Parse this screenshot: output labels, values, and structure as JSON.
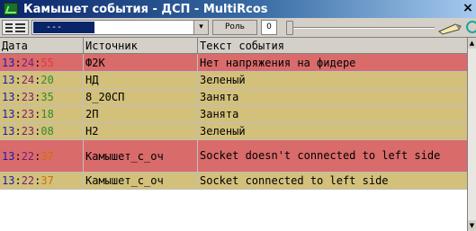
{
  "window": {
    "title": "Камышет события - ДСП - MultiRcos",
    "close_label": "×"
  },
  "toolbar": {
    "combo_value": "---",
    "combo_arrow": "▾",
    "role_label": "Роль",
    "level_value": "0",
    "slider_value": 0
  },
  "columns": [
    "Дата",
    "Источник",
    "Текст события"
  ],
  "rows": [
    {
      "time": {
        "h": "13",
        "m": "24",
        "s": "55"
      },
      "source": "Ф2К",
      "text": "Нет напряжения на фидере",
      "bg": "#d96b6b",
      "height": 20
    },
    {
      "time": {
        "h": "13",
        "m": "24",
        "s": "20"
      },
      "source": "НД",
      "text": "Зеленый",
      "bg": "#d2c07b",
      "height": 19
    },
    {
      "time": {
        "h": "13",
        "m": "23",
        "s": "35"
      },
      "source": "8_20СП",
      "text": "Занята",
      "bg": "#d2c07b",
      "height": 19
    },
    {
      "time": {
        "h": "13",
        "m": "23",
        "s": "18"
      },
      "source": "2П",
      "text": "Занята",
      "bg": "#d2c07b",
      "height": 19
    },
    {
      "time": {
        "h": "13",
        "m": "23",
        "s": "08"
      },
      "source": "Н2",
      "text": "Зеленый",
      "bg": "#d2c07b",
      "height": 19
    },
    {
      "time": {
        "h": "13",
        "m": "22",
        "s": "37"
      },
      "source": "Камышет_с_оч",
      "text": "Socket doesn't connected to left side",
      "bg": "#d96b6b",
      "height": 36
    },
    {
      "time": {
        "h": "13",
        "m": "22",
        "s": "37"
      },
      "source": "Камышет_с_оч",
      "text": "Socket connected to left side",
      "bg": "#d2c07b",
      "height": 19
    }
  ],
  "colors": {
    "hour": "#1b1bb0",
    "minute": "#7a1b7a",
    "second_red": "#e23a3a",
    "second_green": "#2e8b2e",
    "second_orange": "#d07000"
  }
}
